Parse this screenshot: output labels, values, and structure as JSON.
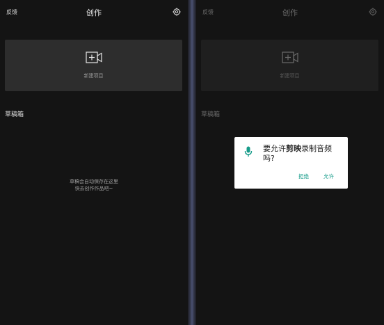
{
  "left": {
    "feedback": "反馈",
    "title": "创作",
    "new_project": "新建项目",
    "drafts": "草稿箱",
    "empty_line1": "草稿会自动保存在这里",
    "empty_line2": "快去创作作品吧~"
  },
  "right": {
    "feedback": "反馈",
    "title": "创作",
    "new_project": "新建项目",
    "drafts": "草稿箱",
    "empty_line1": "",
    "empty_line2": ""
  },
  "dialog": {
    "prompt_before": "要允许",
    "app_name": "剪映",
    "prompt_after": "录制音频吗?",
    "deny": "拒绝",
    "allow": "允许"
  },
  "colors": {
    "accent": "#179c8a",
    "background": "#141414",
    "card": "#2d2d2d"
  },
  "icons": [
    "settings-icon",
    "video-add-icon",
    "microphone-icon"
  ]
}
